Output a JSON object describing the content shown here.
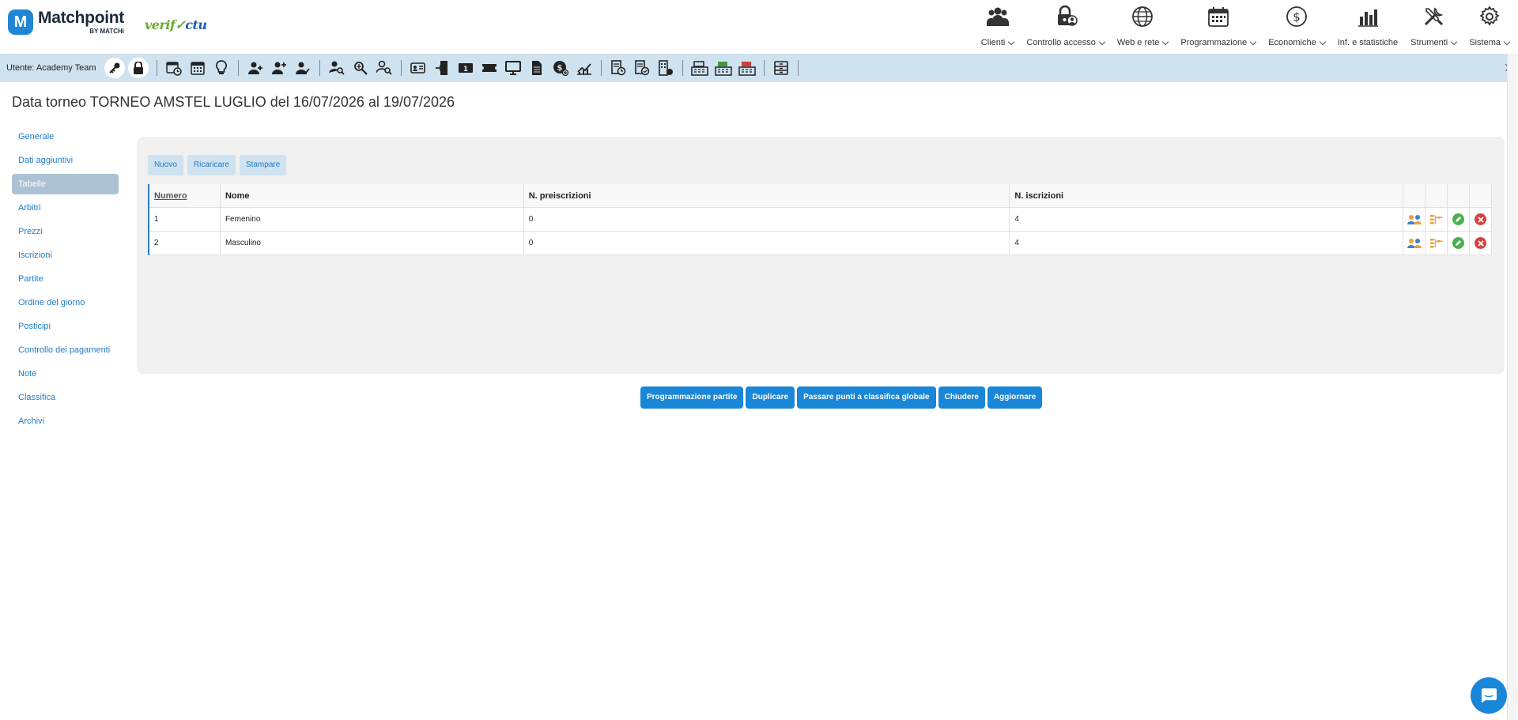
{
  "app": {
    "logo_letter": "M",
    "logo_name": "Matchpoint",
    "logo_sub": "BY MATCHi",
    "verifactu_pre": "verif",
    "verifactu_post": "ctu"
  },
  "topnav": [
    {
      "label": "Clienti",
      "icon": "users-icon"
    },
    {
      "label": "Controllo accesso",
      "icon": "lock-user-icon"
    },
    {
      "label": "Web e rete",
      "icon": "globe-icon"
    },
    {
      "label": "Programmazione",
      "icon": "calendar-icon"
    },
    {
      "label": "Economiche",
      "icon": "dollar-icon"
    },
    {
      "label": "Inf. e statistiche",
      "icon": "bar-chart-icon"
    },
    {
      "label": "Strumenti",
      "icon": "tools-icon"
    },
    {
      "label": "Sistema",
      "icon": "gear-icon"
    }
  ],
  "toolbar": {
    "user_label": "Utente:  Academy Team"
  },
  "page": {
    "title": "Data torneo TORNEO AMSTEL LUGLIO del 16/07/2026 al 19/07/2026"
  },
  "sidebar": {
    "items": [
      {
        "label": "Generale"
      },
      {
        "label": "Dati aggiuntivi"
      },
      {
        "label": "Tabelle"
      },
      {
        "label": "Arbitri"
      },
      {
        "label": "Prezzi"
      },
      {
        "label": "Iscrizioni"
      },
      {
        "label": "Partite"
      },
      {
        "label": "Ordine del giorno"
      },
      {
        "label": "Posticipi"
      },
      {
        "label": "Controllo dei pagamenti"
      },
      {
        "label": "Note"
      },
      {
        "label": "Classifica"
      },
      {
        "label": "Archivi"
      }
    ],
    "active_index": 2
  },
  "panel": {
    "buttons": {
      "new": "Nuovo",
      "reload": "Ricaricare",
      "print": "Stampare"
    },
    "table": {
      "headers": {
        "numero": "Numero",
        "nome": "Nome",
        "preiscrizioni": "N. preiscrizioni",
        "iscrizioni": "N. iscrizioni"
      },
      "rows": [
        {
          "numero": "1",
          "nome": "Femenino",
          "preiscrizioni": "0",
          "iscrizioni": "4"
        },
        {
          "numero": "2",
          "nome": "Masculino",
          "preiscrizioni": "0",
          "iscrizioni": "4"
        }
      ]
    }
  },
  "bottom_buttons": {
    "schedule": "Programmazione partite",
    "duplicate": "Duplicare",
    "points": "Passare punti a classifica globale",
    "close": "Chiudere",
    "update": "Aggiornare"
  },
  "colors": {
    "accent": "#1a86d8",
    "toolbar_bg": "#cfe2ef",
    "sidebar_active": "#aac2d4",
    "link": "#1f7cc9"
  }
}
